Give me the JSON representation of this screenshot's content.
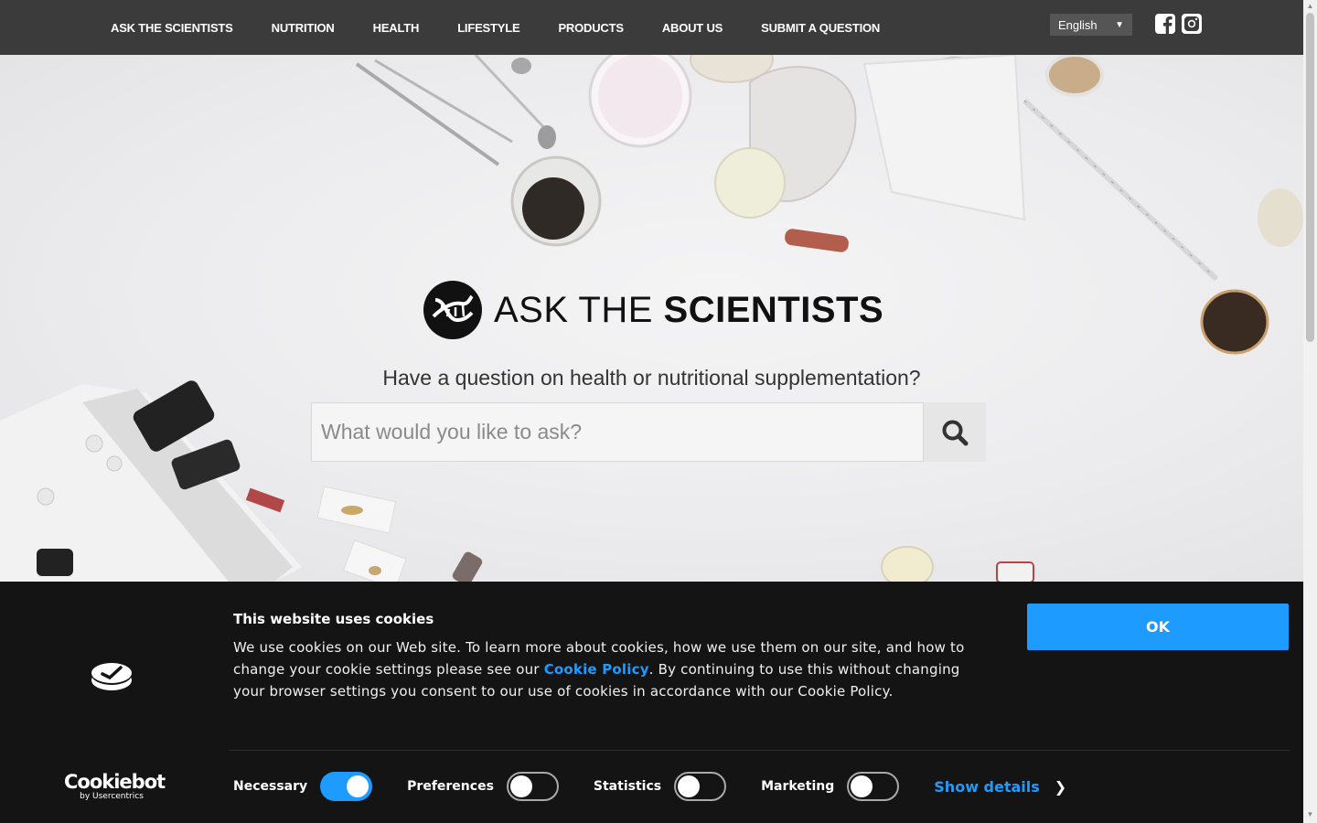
{
  "nav": {
    "items": [
      "ASK THE SCIENTISTS",
      "NUTRITION",
      "HEALTH",
      "LIFESTYLE",
      "PRODUCTS",
      "ABOUT US",
      "SUBMIT A QUESTION"
    ],
    "language": "English",
    "social": [
      "facebook-icon",
      "instagram-icon"
    ]
  },
  "hero": {
    "logo_light": "ASK THE ",
    "logo_bold": "SCIENTISTS",
    "tagline": "Have a question on health or nutritional supplementation?",
    "search_placeholder": "What would you like to ask?"
  },
  "cookie_banner": {
    "title": "This website uses cookies",
    "text_before": "We use cookies on our Web site. To learn more about cookies, how we use them on our site, and how to change your cookie settings please see our ",
    "link": "Cookie Policy",
    "text_after": ". By continuing to use this without changing your browser settings you consent to our use of cookies in accordance with our Cookie Policy.",
    "ok_label": "OK",
    "toggles": [
      {
        "label": "Necessary",
        "on": true
      },
      {
        "label": "Preferences",
        "on": false
      },
      {
        "label": "Statistics",
        "on": false
      },
      {
        "label": "Marketing",
        "on": false
      }
    ],
    "show_details": "Show details",
    "brand": "Cookiebot",
    "brand_sub": "by Usercentrics"
  },
  "colors": {
    "nav_bg": "#3b3b3b",
    "accent": "#1e9bff",
    "banner_bg": "#141414"
  }
}
